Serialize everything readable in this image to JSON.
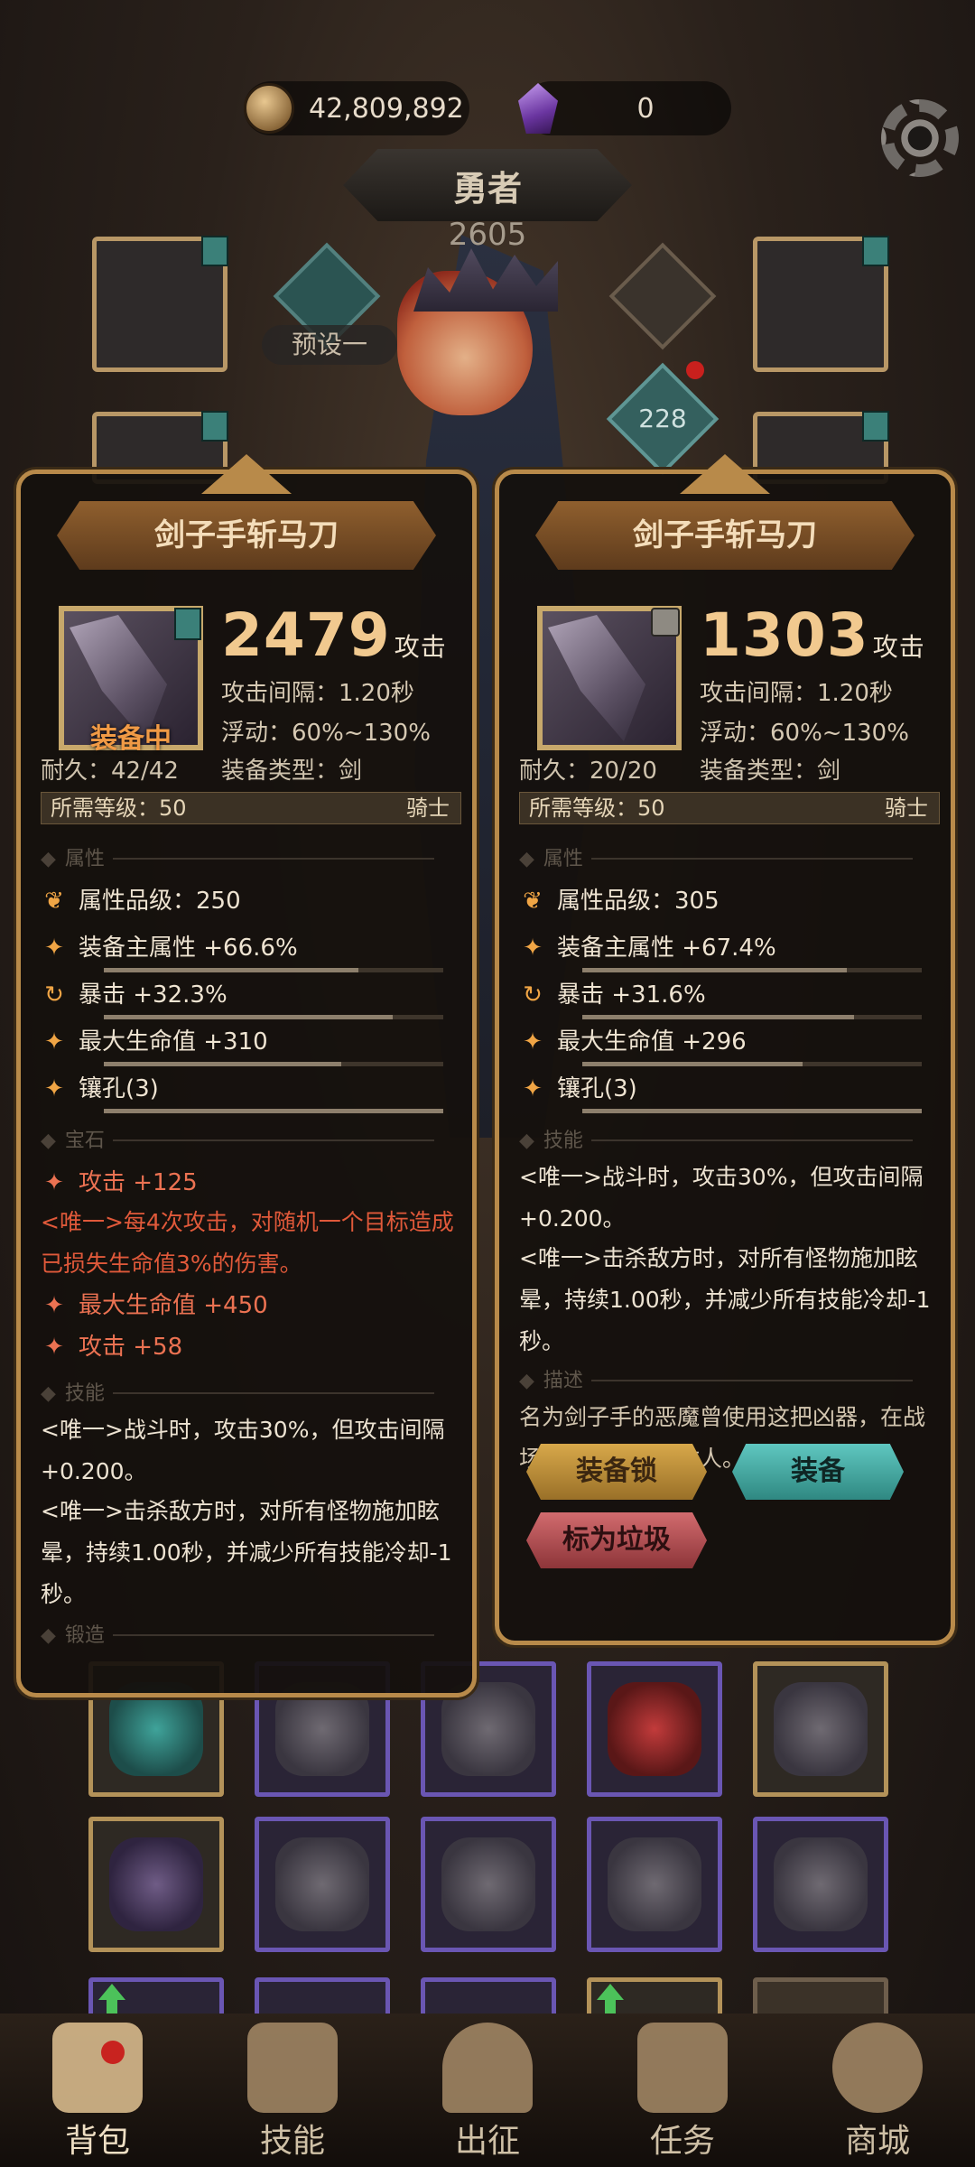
{
  "resources": {
    "gold": "42,809,892",
    "gems": "0"
  },
  "hero": {
    "name": "勇者",
    "power": "2605",
    "preset": "预设一",
    "badge": "228"
  },
  "left_item": {
    "name": "剑子手斩马刀",
    "attack": "2479",
    "attack_unit": "攻击",
    "equipped_label": "装备中",
    "attack_interval": "攻击间隔：1.20秒",
    "float": "浮动：60%~130%",
    "durability": "耐久：42/42",
    "type": "装备类型：剑",
    "req_level": "所需等级：50",
    "class": "骑士",
    "section_attr": "属性",
    "attrs": [
      {
        "text": "属性品级：250",
        "fill": 0
      },
      {
        "text": "装备主属性 +66.6%",
        "fill": 0.75
      },
      {
        "text": "暴击 +32.3%",
        "fill": 0.85
      },
      {
        "text": "最大生命值 +310",
        "fill": 0.7
      },
      {
        "text": "镶孔(3)",
        "fill": 1
      }
    ],
    "section_gem": "宝石",
    "gems": [
      {
        "text": "攻击 +125"
      },
      {
        "text": "最大生命值 +450"
      },
      {
        "text": "攻击 +58"
      }
    ],
    "gem_unique": "<唯一>每4次攻击，对随机一个目标造成已损失生命值3%的伤害。",
    "section_skill": "技能",
    "skills": [
      "<唯一>战斗时，攻击30%，但攻击间隔+0.200。",
      "<唯一>击杀敌方时，对所有怪物施加眩晕，持续1.00秒，并减少所有技能冷却-1秒。"
    ],
    "section_forge": "锻造"
  },
  "right_item": {
    "name": "剑子手斩马刀",
    "attack": "1303",
    "attack_unit": "攻击",
    "attack_interval": "攻击间隔：1.20秒",
    "float": "浮动：60%~130%",
    "durability": "耐久：20/20",
    "type": "装备类型：剑",
    "req_level": "所需等级：50",
    "class": "骑士",
    "section_attr": "属性",
    "attrs": [
      {
        "text": "属性品级：305",
        "fill": 0
      },
      {
        "text": "装备主属性 +67.4%",
        "fill": 0.78
      },
      {
        "text": "暴击 +31.6%",
        "fill": 0.8
      },
      {
        "text": "最大生命值 +296",
        "fill": 0.65
      },
      {
        "text": "镶孔(3)",
        "fill": 1
      }
    ],
    "section_skill": "技能",
    "skills": [
      "<唯一>战斗时，攻击30%，但攻击间隔+0.200。",
      "<唯一>击杀敌方时，对所有怪物施加眩晕，持续1.00秒，并减少所有技能冷却-1秒。"
    ],
    "section_desc": "描述",
    "description": "名为剑子手的恶魔曾使用这把凶器，在战场上斩杀了无数敌人。",
    "btn_lock": "装备锁",
    "btn_equip": "装备",
    "btn_trash": "标为垃圾"
  },
  "nav": [
    "背包",
    "技能",
    "出征",
    "任务",
    "商城"
  ],
  "colors": {
    "accent_gold": "#f1c98f",
    "unique_red": "#e0593a",
    "equip_teal": "#3fa7a0"
  }
}
